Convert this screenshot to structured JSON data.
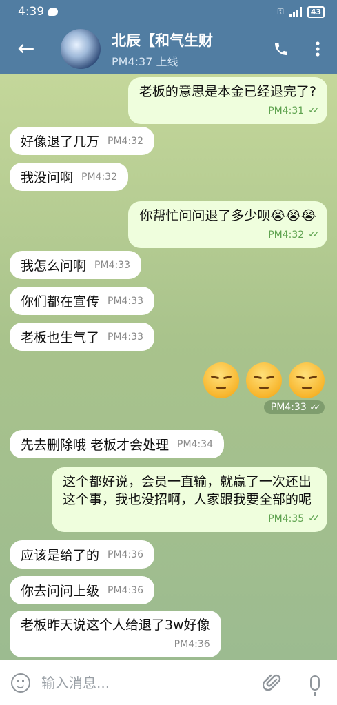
{
  "status": {
    "time": "4:39",
    "battery": "43"
  },
  "header": {
    "title": "北辰【和气生财",
    "subtitle": "PM4:37 上线"
  },
  "messages": [
    {
      "dir": "out",
      "text": "老板的意思是本金已经退完了?",
      "time": "PM4:31"
    },
    {
      "dir": "in",
      "text": "好像退了几万",
      "time": "PM4:32"
    },
    {
      "dir": "in",
      "text": "我没问啊",
      "time": "PM4:32"
    },
    {
      "dir": "out",
      "text": "你帮忙问问退了多少呗😭😭😭",
      "time": "PM4:32"
    },
    {
      "dir": "in",
      "text": "我怎么问啊",
      "time": "PM4:33"
    },
    {
      "dir": "in",
      "text": "你们都在宣传",
      "time": "PM4:33"
    },
    {
      "dir": "in",
      "text": "老板也生气了",
      "time": "PM4:33"
    },
    {
      "dir": "in",
      "text": "先去删除哦 老板才会处理",
      "time": "PM4:34"
    },
    {
      "dir": "out",
      "text": "这个都好说，会员一直输，就赢了一次还出这个事，我也没招啊，人家跟我要全部的呢",
      "time": "PM4:35"
    },
    {
      "dir": "in",
      "text": "应该是给了的",
      "time": "PM4:36"
    },
    {
      "dir": "in",
      "text": "你去问问上级",
      "time": "PM4:36"
    },
    {
      "dir": "in",
      "text": "老板昨天说这个人给退了3w好像",
      "time": "PM4:36"
    }
  ],
  "sticker": {
    "emoji": [
      "pensive-face",
      "pensive-face",
      "pensive-face"
    ],
    "time": "PM4:33"
  },
  "composer": {
    "placeholder": "输入消息..."
  },
  "colors": {
    "header": "#517da2",
    "outgoing": "#effedd",
    "incoming": "#ffffff",
    "check": "#5fa350"
  }
}
